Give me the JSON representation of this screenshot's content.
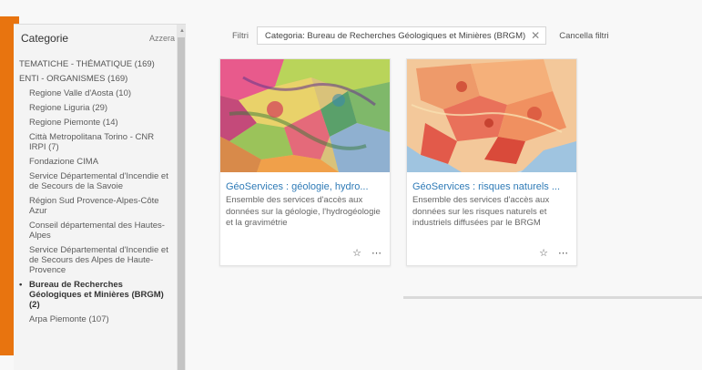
{
  "sidebar": {
    "title": "Categorie",
    "reset": "Azzera",
    "items": [
      {
        "label": "TEMATICHE - THÉMATIQUE  (169)",
        "kind": "top"
      },
      {
        "label": "ENTI - ORGANISMES  (169)",
        "kind": "top"
      },
      {
        "label": "Regione Valle d'Aosta  (10)",
        "kind": "sub"
      },
      {
        "label": "Regione Liguria  (29)",
        "kind": "sub"
      },
      {
        "label": "Regione Piemonte  (14)",
        "kind": "sub"
      },
      {
        "label": "Città Metropolitana Torino - CNR IRPI  (7)",
        "kind": "sub"
      },
      {
        "label": "Fondazione CIMA",
        "kind": "sub"
      },
      {
        "label": "Service Départemental d'Incendie et de Secours de la Savoie",
        "kind": "sub"
      },
      {
        "label": "Région Sud Provence-Alpes-Côte Azur",
        "kind": "sub"
      },
      {
        "label": "Conseil départemental des Hautes-Alpes",
        "kind": "sub"
      },
      {
        "label": "Service Départemental d'Incendie et de Secours des Alpes de Haute-Provence",
        "kind": "sub"
      },
      {
        "label": "Bureau de Recherches Géologiques et Minières (BRGM)  (2)",
        "kind": "selected"
      },
      {
        "label": "Arpa Piemonte  (107)",
        "kind": "sub"
      }
    ]
  },
  "filters": {
    "label": "Filtri",
    "active": "Categoria: Bureau de Recherches Géologiques et Minières (BRGM)",
    "clear": "Cancella filtri"
  },
  "cards": [
    {
      "title": "GéoServices : géologie, hydro...",
      "description": "Ensemble des services d'accès aux données sur la géologie, l'hydrogéologie et la gravimétrie",
      "favorite_icon": "star-icon",
      "more_icon": "more-icon"
    },
    {
      "title": "GéoServices : risques naturels ...",
      "description": "Ensemble des services d'accès aux données sur les risques naturels et industriels diffusées par le BRGM",
      "favorite_icon": "star-icon",
      "more_icon": "more-icon"
    }
  ],
  "colors": {
    "accent": "#e8740f",
    "link": "#2f7bb7"
  }
}
